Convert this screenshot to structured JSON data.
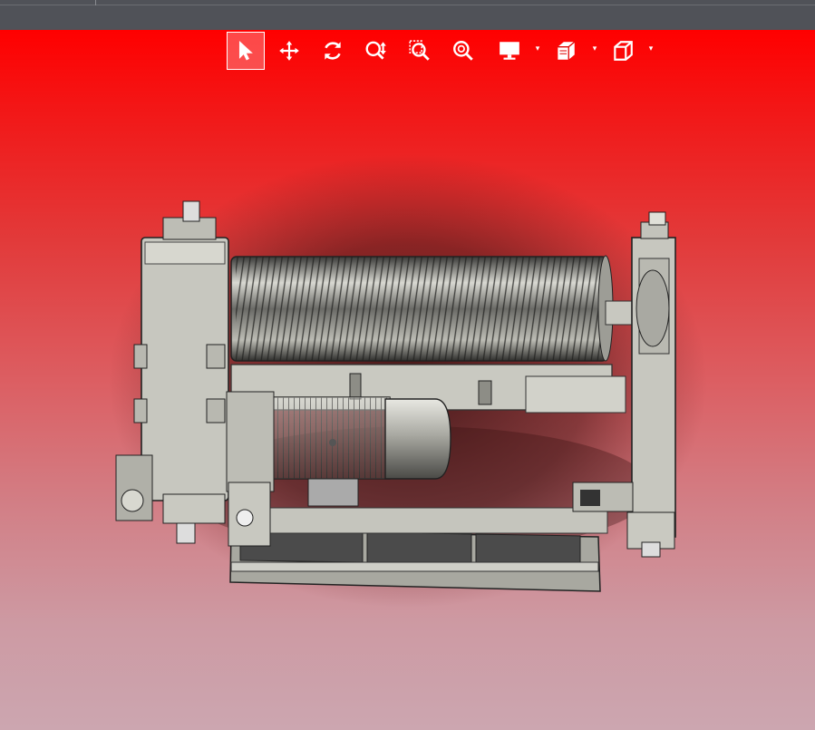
{
  "window": {
    "title": ""
  },
  "toolbar": {
    "tools": [
      {
        "name": "select",
        "icon": "cursor-arrow-icon",
        "active": true
      },
      {
        "name": "pan",
        "icon": "move-arrows-icon",
        "active": false
      },
      {
        "name": "rotate",
        "icon": "rotate-icon",
        "active": false
      },
      {
        "name": "zoom-in-out",
        "icon": "zoom-in-out-icon",
        "active": false
      },
      {
        "name": "zoom-window",
        "icon": "zoom-window-icon",
        "active": false
      },
      {
        "name": "zoom-fit",
        "icon": "zoom-fit-icon",
        "active": false
      },
      {
        "name": "display-settings",
        "icon": "monitor-icon",
        "has_dropdown": true
      },
      {
        "name": "section-view",
        "icon": "section-cut-icon",
        "has_dropdown": true
      },
      {
        "name": "view-orientation",
        "icon": "view-cube-icon",
        "has_dropdown": true
      }
    ],
    "dropdown_glyph": "▾"
  },
  "viewport": {
    "background_top": "#ff0000",
    "background_bottom": "#cca6b0",
    "model": "winch-assembly",
    "model_color": "#bfbfb8"
  }
}
